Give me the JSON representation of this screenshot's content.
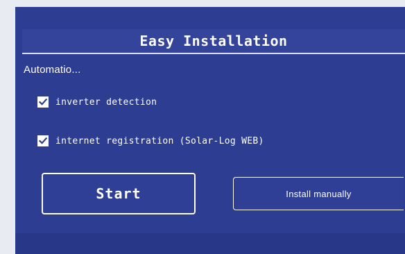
{
  "window": {
    "title": "Easy Installation"
  },
  "section": {
    "heading": "Automatio..."
  },
  "options": [
    {
      "label": "inverter detection",
      "checked": true
    },
    {
      "label": "internet registration (Solar-Log WEB)",
      "checked": true
    }
  ],
  "buttons": {
    "start_label": "Start",
    "manual_label": "Install manually"
  },
  "colors": {
    "screen_background": "#2d3d92",
    "text": "#ffffff",
    "checkbox_fill": "#ffffff",
    "checkmark": "#2d3d92"
  },
  "icons": {
    "checkbox": "checkmark-icon"
  }
}
